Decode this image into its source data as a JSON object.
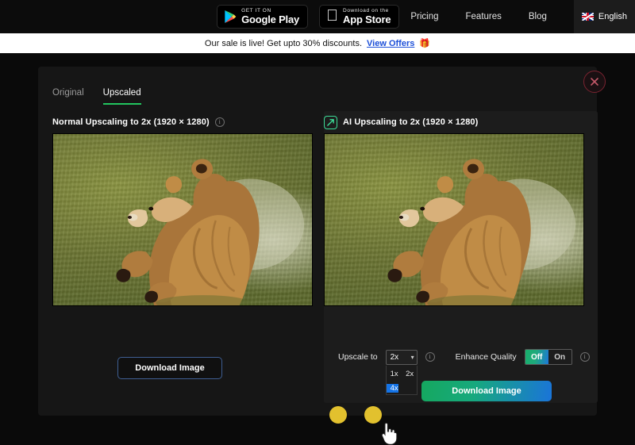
{
  "topnav": {
    "google_play": {
      "small": "GET IT ON",
      "big": "Google Play"
    },
    "app_store": {
      "small": "Download on the",
      "big": "App Store"
    },
    "links": [
      {
        "label": "Pricing"
      },
      {
        "label": "Features"
      },
      {
        "label": "Blog"
      }
    ],
    "language": "English"
  },
  "promo": {
    "text": "Our sale is live! Get upto 30% discounts.",
    "link": "View Offers",
    "gift_icon": "🎁"
  },
  "modal": {
    "close_icon": "close-icon",
    "tabs": [
      {
        "label": "Original",
        "active": false
      },
      {
        "label": "Upscaled",
        "active": true
      }
    ],
    "left": {
      "title": "Normal Upscaling to 2x (1920 × 1280)",
      "info_icon": "i",
      "download_label": "Download Image"
    },
    "right": {
      "badge_icon": "ai-expand-icon",
      "title": "AI Upscaling to 2x (1920 × 1280)",
      "upscale_label": "Upscale to",
      "upscale_value": "2x",
      "upscale_caret": "▼",
      "upscale_options": [
        {
          "label": "1x",
          "selected": false
        },
        {
          "label": "2x",
          "selected": false
        },
        {
          "label": "4x",
          "selected": true
        }
      ],
      "upscale_info_icon": "i",
      "enhance_label": "Enhance Quality",
      "enhance_off": "Off",
      "enhance_on": "On",
      "enhance_value": "Off",
      "enhance_info_icon": "i",
      "download_label": "Download Image"
    }
  },
  "colors": {
    "page_bg": "#0a0a0a",
    "modal_bg": "#161616",
    "panel_bg": "#1c1c1c",
    "accent_green": "#22c55e",
    "accent_blue": "#1473e6",
    "link_blue": "#1c4fd8",
    "close_red": "#7a2330",
    "gradient_from": "#15a85f",
    "gradient_to": "#1a74d9",
    "dot_yellow": "#e2c12e"
  }
}
